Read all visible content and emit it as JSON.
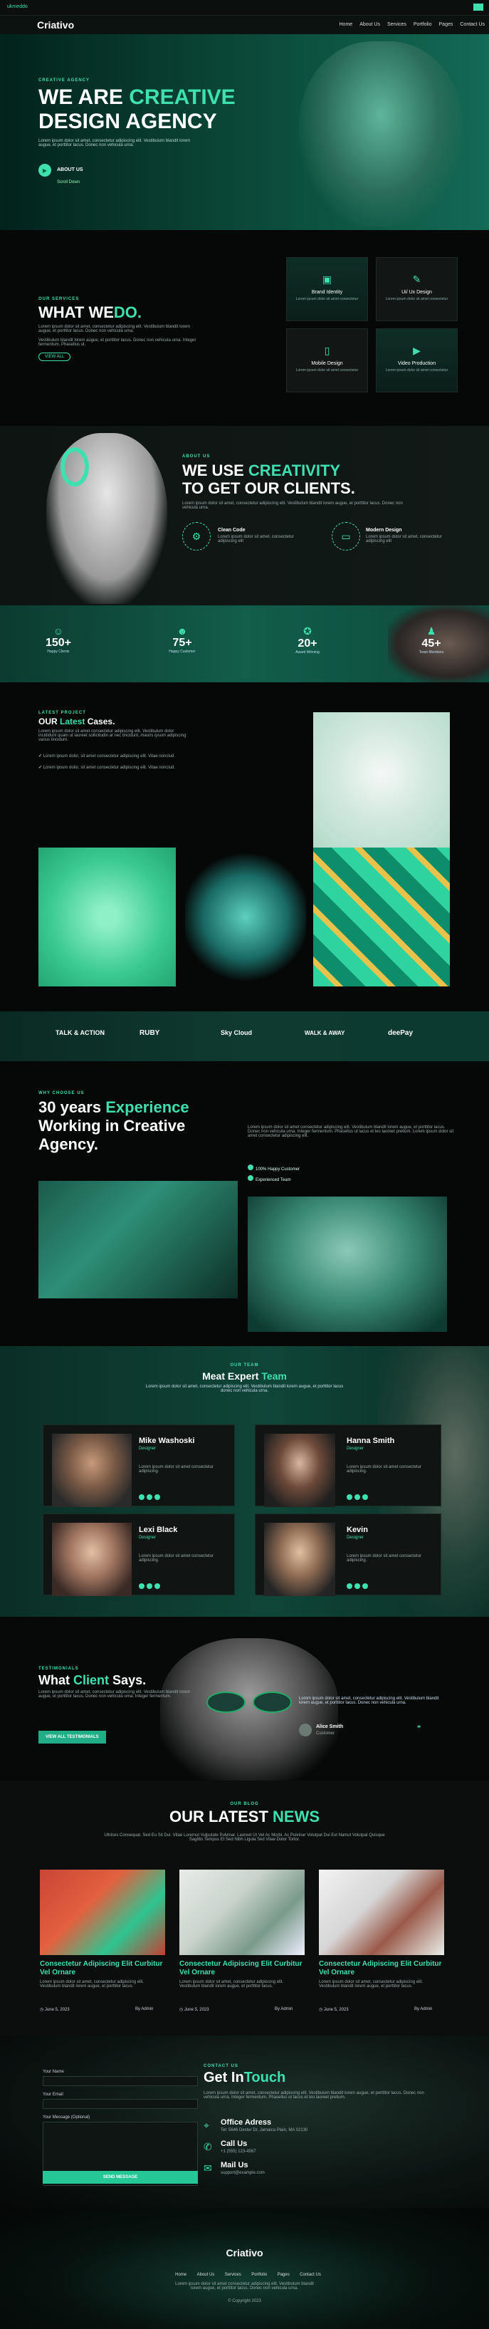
{
  "topbar": {
    "left": "ukmeddo",
    "right": ""
  },
  "header": {
    "logo": "Criativo",
    "nav": [
      "Home",
      "About Us",
      "Services",
      "Portfolio",
      "Pages",
      "Contact Us"
    ]
  },
  "hero": {
    "tag": "CREATIVE AGENCY",
    "title_line1_a": "WE ARE",
    "title_line1_b": "CREATIVE",
    "title_line2": "DESIGN AGENCY",
    "text": "Lorem ipsum dolor sit amet, consectetur adipiscing elit. Vestibulum blandit lorem augue, et porttitor lacus. Donec non vehicula urna.",
    "button": "ABOUT US",
    "sublink": "Scroll Down"
  },
  "whatwedo": {
    "tag": "OUR SERVICES",
    "title_a": "WHAT WE",
    "title_b": "DO.",
    "text1": "Lorem ipsum dolor sit amet, consectetur adipiscing elit. Vestibulum blandit lorem augue, et porttitor lacus. Donec non vehicula urna.",
    "text2": "Vestibulum blandit lorem augue, et porttitor lacus. Donec non vehicula urna. Integer fermentum. Phasellus ut.",
    "button": "VIEW ALL",
    "services": [
      {
        "name": "Brand Identity",
        "desc": "Lorem ipsum dolor sit amet consectetur",
        "icon": "brand-icon"
      },
      {
        "name": "Ui/ Ux Design",
        "desc": "Lorem ipsum dolor sit amet consectetur",
        "icon": "design-icon"
      },
      {
        "name": "Mobile Design",
        "desc": "Lorem ipsum dolor sit amet consectetur",
        "icon": "mobile-icon"
      },
      {
        "name": "Video Production",
        "desc": "Lorem ipsum dolor sit amet consectetur",
        "icon": "video-icon"
      }
    ]
  },
  "creativity": {
    "tag": "ABOUT US",
    "title_line1_a": "WE USE",
    "title_line1_b": "CREATIVITY",
    "title_line2": "TO GET OUR CLIENTS.",
    "text": "Lorem ipsum dolor sit amet, consectetur adipiscing elit. Vestibulum blandit lorem augue, et porttitor lacus. Donec non vehicula urna.",
    "features": [
      {
        "name": "Clean Code",
        "desc": "Lorem ipsum dolor sit amet, consectetur adipiscing elit",
        "icon": "code-icon"
      },
      {
        "name": "Modern Design",
        "desc": "Lorem ipsum dolor sit amet, consectetur adipiscing elit",
        "icon": "monitor-icon"
      }
    ]
  },
  "stats": [
    {
      "value": "150+",
      "label": "Happy Clients",
      "icon": "smile-icon"
    },
    {
      "value": "75+",
      "label": "Happy Customer",
      "icon": "users-icon"
    },
    {
      "value": "20+",
      "label": "Award Winning",
      "icon": "award-icon"
    },
    {
      "value": "45+",
      "label": "Team Members",
      "icon": "team-icon"
    }
  ],
  "cases": {
    "tag": "LATEST PROJECT",
    "title_a": "OUR",
    "title_b": "Latest",
    "title_c": "Cases.",
    "text": "Lorem ipsum dolor sit amet consectetur adipiscing elit. Vestibulum dolor incididunt quam ut laoreet sollicitudin at nec tincidunt, mauris ipsum adipiscing varius tincidunt.",
    "bullet1": "Lorem ipsum dolor, sit amet consectetur adipiscing elit. Vitae nonclud.",
    "bullet2": "Lorem ipsum dolor, sit amet consectetur adipiscing elit. Vitae nonclud."
  },
  "clients": [
    "TALK & ACTION",
    "RUBY",
    "Sky Cloud",
    "WALK & AWAY",
    "deePay"
  ],
  "experience": {
    "tag": "WHY CHOOSE US",
    "title_a": "30 years",
    "title_b": "Experience",
    "title_line2": "Working in Creative",
    "title_line3": "Agency.",
    "text": "Lorem ipsum dolor sit amet consectetur adipiscing elit. Vestibulum blandit lorem augue, et porttitor lacus. Donec non vehicula urna. Integer fermentum. Phasellus ut lacus et leo laoreet pretium. Lorem ipsum dolor sit amet consectetur adipiscing elit.",
    "check1": "100% Happy Customer",
    "check2": "Experienced Team"
  },
  "team": {
    "tag": "OUR TEAM",
    "title_a": "Meat Expert",
    "title_b": "Team",
    "text": "Lorem ipsum dolor sit amet, consectetur adipiscing elit. Vestibulum blandit lorem augue, et porttitor lacus donec non vehicula urna.",
    "members": [
      {
        "name": "Mike Washoski",
        "role": "Designer",
        "desc": "Lorem ipsum dolor sit amet consectetur adipiscing."
      },
      {
        "name": "Hanna Smith",
        "role": "Designer",
        "desc": "Lorem ipsum dolor sit amet consectetur adipiscing."
      },
      {
        "name": "Lexi Black",
        "role": "Designer",
        "desc": "Lorem ipsum dolor sit amet consectetur adipiscing."
      },
      {
        "name": "Kevin",
        "role": "Designer",
        "desc": "Lorem ipsum dolor sit amet consectetur adipiscing."
      }
    ]
  },
  "testimonials": {
    "tag": "TESTIMONIALS",
    "title_a": "What",
    "title_b": "Client",
    "title_c": "Says.",
    "text": "Lorem ipsum dolor sit amet, consectetur adipiscing elit. Vestibulum blandit lorem augue, et porttitor lacus. Donec non vehicula urna. Integer fermentum.",
    "button": "VIEW ALL TESTIMONIALS",
    "quote": "Lorem ipsum dolor sit amet, consectetur adipiscing elit. Vestibulum blandit lorem augue, et porttitor lacus. Donec non vehicula urna.",
    "author": "Alice Smith",
    "author_role": "Customer"
  },
  "news": {
    "tag": "OUR BLOG",
    "title_a": "OUR LATEST",
    "title_b": "NEWS",
    "text": "Ultrices Consequat. Sed Eu Sit Dui. Vitae Loremut Vulputate Pulvinar. Laoreet Ut Vel Ac Morbi. Ac Pulvinar Volutpat Dui Est Namut Volutpat Quisque Sagittis Tempus Et Sed Nibh Ligula Sed Vitae Dolor Tortor.",
    "posts": [
      {
        "title": "Consectetur Adipiscing Elit Curbitur Vel Ornare",
        "text": "Lorem ipsum dolor sit amet, consectetur adipiscing elit. Vestibulum blandit lorem augue, et porttitor lacus.",
        "date": "June 5, 2023",
        "author": "By Admin"
      },
      {
        "title": "Consectetur Adipiscing Elit Curbitur Vel Ornare",
        "text": "Lorem ipsum dolor sit amet, consectetur adipiscing elit. Vestibulum blandit lorem augue, et porttitor lacus.",
        "date": "June 5, 2023",
        "author": "By Admin"
      },
      {
        "title": "Consectetur Adipiscing Elit Curbitur Vel Ornare",
        "text": "Lorem ipsum dolor sit amet, consectetur adipiscing elit. Vestibulum blandit lorem augue, et porttitor lacus.",
        "date": "June 5, 2023",
        "author": "By Admin"
      }
    ]
  },
  "contact": {
    "form": {
      "name_label": "Your Name",
      "email_label": "Your Email",
      "message_label": "Your Message (Optional)",
      "submit": "SEND MESSAGE"
    },
    "tag": "CONTACT US",
    "title_a": "Get In",
    "title_b": "Touch",
    "text": "Lorem ipsum dolor sit amet, consectetur adipiscing elit. Vestibulum blandit lorem augue, et porttitor lacus. Donec non vehicula urna. Integer fermentum. Phasellus ut lacus et leo laoreet pretium.",
    "office_label": "Office Adress",
    "office_value": "Tel: 5646 Dexter Dr, Jamaica Plain, MA 02130",
    "call_label": "Call Us",
    "call_value": "+1 (555) 123-4567",
    "mail_label": "Mail Us",
    "mail_value": "support@example.com"
  },
  "footer": {
    "logo": "Criativo",
    "nav": [
      "Home",
      "About Us",
      "Services",
      "Portfolio",
      "Pages",
      "Contact Us"
    ],
    "text": "Lorem ipsum dolor sit amet consectetur adipiscing elit. Vestibulum blandit lorem augue, et porttitor lacus. Donec non vehicula urna.",
    "copyright": "© Copyright 2023"
  },
  "colors": {
    "accent": "#3fe0b0",
    "accent_dark": "#1fae85",
    "bg": "#050807"
  }
}
